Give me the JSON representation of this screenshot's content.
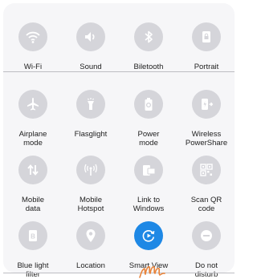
{
  "tiles": [
    {
      "label": "Wi-Fi",
      "icon": "wifi-icon"
    },
    {
      "label": "Sound",
      "icon": "volume-icon"
    },
    {
      "label": "Biletooth",
      "icon": "bluetooth-icon"
    },
    {
      "label": "Portrait",
      "icon": "portrait-lock-icon"
    },
    {
      "label": "Airplane\nmode",
      "icon": "airplane-icon"
    },
    {
      "label": "Flasglight",
      "icon": "flashlight-icon"
    },
    {
      "label": "Power\nmode",
      "icon": "battery-icon"
    },
    {
      "label": "Wireless\nPowerShare",
      "icon": "wireless-powershare-icon"
    },
    {
      "label": "Mobile\ndata",
      "icon": "mobile-data-icon"
    },
    {
      "label": "Mobile\nHotspot",
      "icon": "hotspot-icon"
    },
    {
      "label": "Link to\nWindows",
      "icon": "link-to-windows-icon"
    },
    {
      "label": "Scan QR\ncode",
      "icon": "qr-code-icon"
    },
    {
      "label": "Blue light\nfilter",
      "icon": "blue-light-filter-icon"
    },
    {
      "label": "Location",
      "icon": "location-pin-icon"
    },
    {
      "label": "Smart View",
      "icon": "smart-view-icon",
      "active": true
    },
    {
      "label": "Do not\ndisturb",
      "icon": "do-not-disturb-icon"
    }
  ],
  "colors": {
    "panel": "#f6f6f8",
    "tile_off": "#d5d5da",
    "tile_on": "#1e88e5",
    "icon": "#ffffff",
    "hand": "#e8833a"
  }
}
